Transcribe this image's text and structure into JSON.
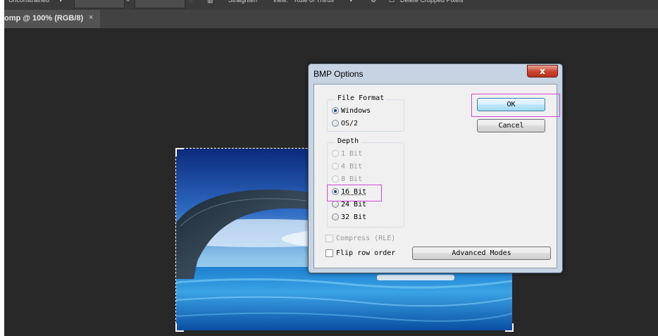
{
  "options_bar": {
    "ratio_select": "Unconstrained",
    "swap_symbol": "×",
    "straighten_label": "Straighten",
    "view_label": "View:",
    "view_select": "Rule of Thirds",
    "delete_cropped_label": "Delete Cropped Pixels"
  },
  "document_tab": {
    "label": "omp @ 100% (RGB/8)",
    "close": "×"
  },
  "dialog": {
    "title": "BMP Options",
    "close_glyph": "x",
    "file_format": {
      "title": "File Format",
      "options": [
        "Windows",
        "OS/2"
      ],
      "selected": "Windows"
    },
    "depth": {
      "title": "Depth",
      "options": [
        "1 Bit",
        "4 Bit",
        "8 Bit",
        "16 Bit",
        "24 Bit",
        "32 Bit"
      ],
      "selected": "16 Bit",
      "disabled": [
        "1 Bit",
        "4 Bit",
        "8 Bit"
      ]
    },
    "compress_label": "Compress (RLE)",
    "flip_label": "Flip row order",
    "ok_label": "OK",
    "cancel_label": "Cancel",
    "advanced_label": "Advanced Modes"
  },
  "colors": {
    "canvas": "#282828",
    "highlight": "#d04ad8",
    "dialog_frame": "#c5d3e3"
  }
}
